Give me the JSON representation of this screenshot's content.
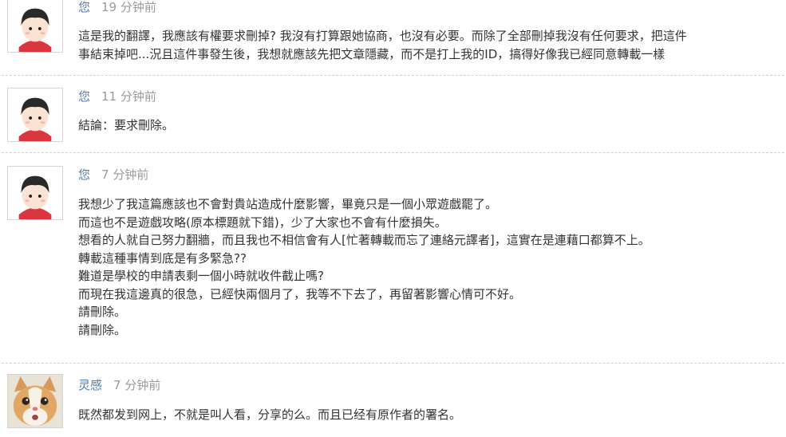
{
  "comments": [
    {
      "author": "您",
      "time": "19 分钟前",
      "avatar_icon": "user-avatar-icon",
      "lines": [
        "這是我的翻譯，我應該有權要求刪掉? 我沒有打算跟她協商，也沒有必要。而除了全部刪掉我沒有任何要求，把這件",
        "事結束掉吧...況且這件事發生後，我想就應該先把文章隱藏，而不是打上我的ID，搞得好像我已經同意轉載一樣"
      ]
    },
    {
      "author": "您",
      "time": "11 分钟前",
      "avatar_icon": "user-avatar-icon",
      "lines": [
        "結論：要求刪除。"
      ]
    },
    {
      "author": "您",
      "time": "7 分钟前",
      "avatar_icon": "user-avatar-icon",
      "lines": [
        "我想少了我這篇應該也不會對貴站造成什麼影響，畢竟只是一個小眾遊戲罷了。",
        "而這也不是遊戲攻略(原本標題就下錯)，少了大家也不會有什麼損失。",
        "想看的人就自己努力翻牆，而且我也不相信會有人[忙著轉載而忘了連絡元譯者]，這實在是連藉口都算不上。",
        "轉載這種事情到底是有多緊急??",
        "難道是學校的申請表剩一個小時就收件截止嗎?",
        "而現在我這邊真的很急，已經快兩個月了，我等不下去了，再留著影響心情可不好。",
        "請刪除。",
        "請刪除。"
      ]
    },
    {
      "author": "灵感",
      "time": "7 分钟前",
      "avatar_icon": "cat-avatar-icon",
      "lines": [
        "既然都发到网上，不就是叫人看，分享的么。而且已经有原作者的署名。"
      ]
    }
  ],
  "colors": {
    "author_link": "#4f7ea8",
    "timestamp": "#999999",
    "body_text": "#333333",
    "divider": "#cfcfcf"
  }
}
